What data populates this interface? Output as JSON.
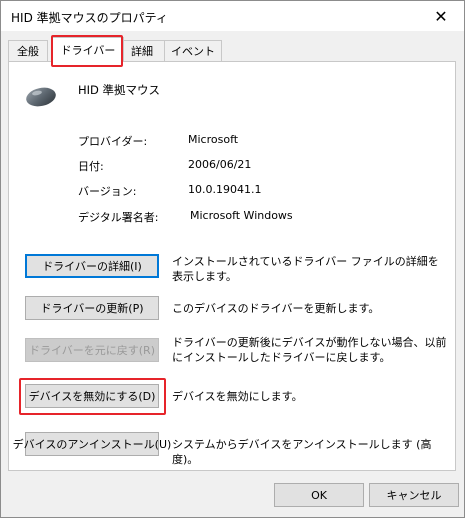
{
  "window": {
    "title": "HID 準拠マウスのプロパティ",
    "close_glyph": "✕"
  },
  "tabs": [
    {
      "label": "全般"
    },
    {
      "label": "ドライバー"
    },
    {
      "label": "詳細"
    },
    {
      "label": "イベント"
    }
  ],
  "device": {
    "name": "HID 準拠マウス",
    "icon": "mouse-icon"
  },
  "info": [
    {
      "label": "プロバイダー:",
      "value": "Microsoft"
    },
    {
      "label": "日付:",
      "value": "2006/06/21"
    },
    {
      "label": "バージョン:",
      "value": "10.0.19041.1"
    },
    {
      "label": "デジタル署名者:",
      "value": "Microsoft Windows"
    }
  ],
  "actions": [
    {
      "button": "ドライバーの詳細(I)",
      "description": "インストールされているドライバー ファイルの詳細を表示します。"
    },
    {
      "button": "ドライバーの更新(P)",
      "description": "このデバイスのドライバーを更新します。"
    },
    {
      "button": "ドライバーを元に戻す(R)",
      "description": "ドライバーの更新後にデバイスが動作しない場合、以前にインストールしたドライバーに戻します。"
    },
    {
      "button": "デバイスを無効にする(D)",
      "description": "デバイスを無効にします。"
    },
    {
      "button": "デバイスのアンインストール(U)",
      "description": "システムからデバイスをアンインストールします (高度)。"
    }
  ],
  "footer": {
    "ok": "OK",
    "cancel": "キャンセル"
  },
  "colors": {
    "highlight": "#e6242a",
    "focus": "#0078d7"
  }
}
